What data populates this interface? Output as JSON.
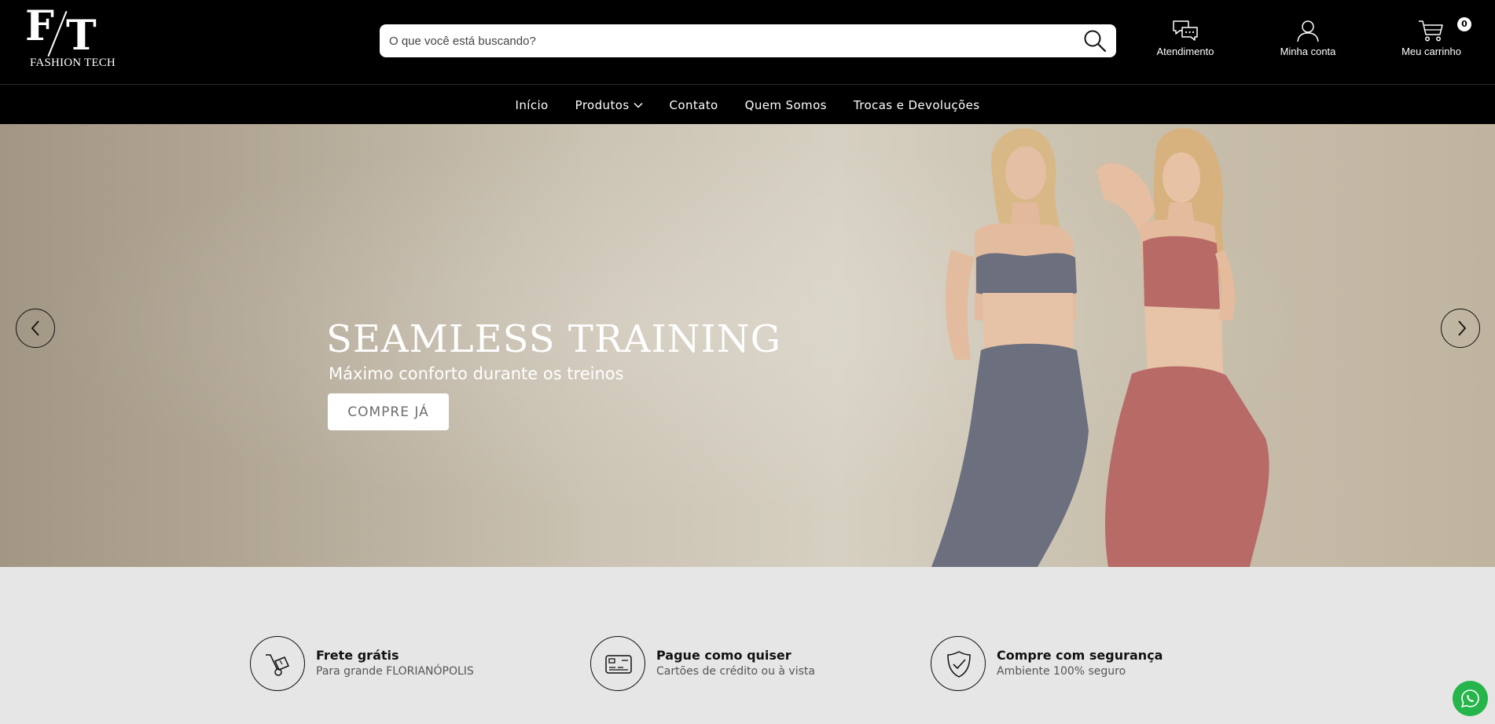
{
  "brand": {
    "monogram_left": "F",
    "monogram_right": "T",
    "name": "FASHION TECH"
  },
  "search": {
    "placeholder": "O que você está buscando?"
  },
  "header_actions": {
    "support": "Atendimento",
    "account": "Minha conta",
    "cart": "Meu carrinho",
    "cart_count": "0"
  },
  "nav": {
    "items": [
      {
        "label": "Início",
        "dropdown": false
      },
      {
        "label": "Produtos",
        "dropdown": true
      },
      {
        "label": "Contato",
        "dropdown": false
      },
      {
        "label": "Quem Somos",
        "dropdown": false
      },
      {
        "label": "Trocas e Devoluções",
        "dropdown": false
      }
    ]
  },
  "hero": {
    "title": "SEAMLESS TRAINING",
    "subtitle": "Máximo conforto durante os treinos",
    "cta": "COMPRE JÁ"
  },
  "benefits": [
    {
      "title": "Frete grátis",
      "subtitle": "Para grande FLORIANÓPOLIS",
      "icon": "hand-truck-icon"
    },
    {
      "title": "Pague como quiser",
      "subtitle": "Cartões de crédito ou à vista",
      "icon": "credit-card-icon"
    },
    {
      "title": "Compre com segurança",
      "subtitle": "Ambiente 100% seguro",
      "icon": "shield-check-icon"
    }
  ],
  "colors": {
    "header_bg": "#000000",
    "page_bg": "#e6e6e6",
    "whatsapp": "#25b54a",
    "leggings_left": "#6b6f7e",
    "leggings_right": "#b86a67"
  }
}
